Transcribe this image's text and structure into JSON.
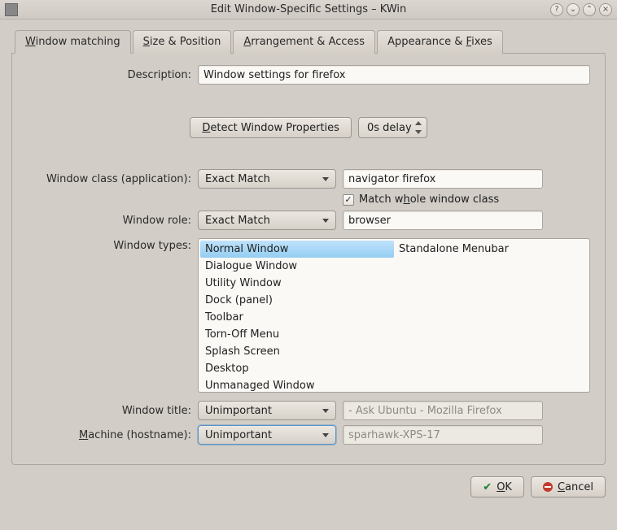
{
  "window": {
    "title": "Edit Window-Specific Settings – KWin"
  },
  "tabs": {
    "matching": "Window matching",
    "size": "Size & Position",
    "arrangement": "Arrangement & Access",
    "appearance": "Appearance & Fixes"
  },
  "labels": {
    "description": "Description:",
    "detect": "Detect Window Properties",
    "delay": "0s delay",
    "window_class": "Window class (application):",
    "window_role": "Window role:",
    "window_types": "Window types:",
    "window_title": "Window title:",
    "machine": "Machine (hostname):",
    "match_whole": "Match whole window class"
  },
  "values": {
    "description": "Window settings for firefox",
    "class_match": "Exact Match",
    "class_value": "navigator firefox",
    "role_match": "Exact Match",
    "role_value": "browser",
    "title_match": "Unimportant",
    "title_value": "- Ask Ubuntu - Mozilla Firefox",
    "machine_match": "Unimportant",
    "machine_value": "sparhawk-XPS-17",
    "match_whole_checked": "✓"
  },
  "types": {
    "col1": [
      "Normal Window",
      "Dialogue Window",
      "Utility Window",
      "Dock (panel)",
      "Toolbar",
      "Torn-Off Menu",
      "Splash Screen",
      "Desktop",
      "Unmanaged Window"
    ],
    "col2": [
      "Standalone Menubar"
    ]
  },
  "buttons": {
    "ok": "OK",
    "cancel": "Cancel"
  }
}
